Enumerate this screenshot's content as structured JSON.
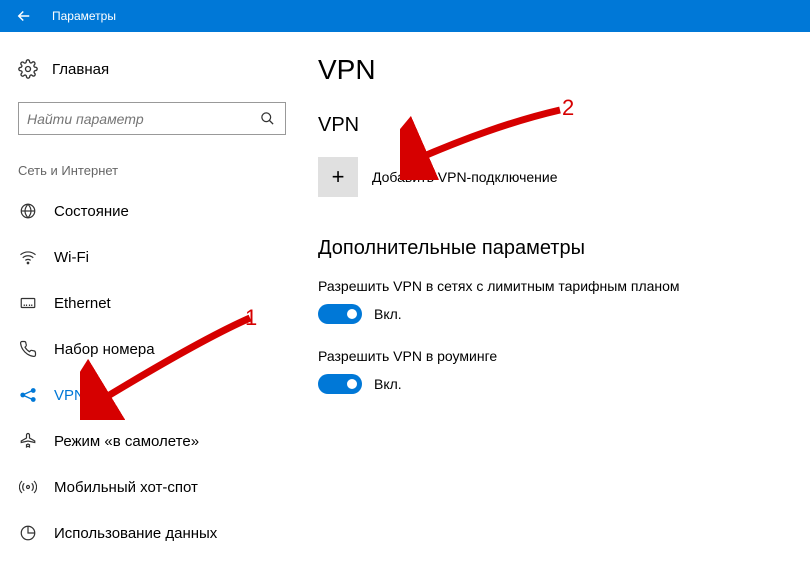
{
  "titlebar": {
    "title": "Параметры"
  },
  "sidebar": {
    "home_label": "Главная",
    "search_placeholder": "Найти параметр",
    "category_label": "Сеть и Интернет",
    "items": [
      {
        "label": "Состояние"
      },
      {
        "label": "Wi-Fi"
      },
      {
        "label": "Ethernet"
      },
      {
        "label": "Набор номера"
      },
      {
        "label": "VPN"
      },
      {
        "label": "Режим «в самолете»"
      },
      {
        "label": "Мобильный хот-спот"
      },
      {
        "label": "Использование данных"
      }
    ]
  },
  "main": {
    "page_title": "VPN",
    "vpn_heading": "VPN",
    "add_vpn_label": "Добавить VPN-подключение",
    "advanced_heading": "Дополнительные параметры",
    "settings": [
      {
        "label": "Разрешить VPN в сетях с лимитным тарифным планом",
        "state": "Вкл."
      },
      {
        "label": "Разрешить VPN в роуминге",
        "state": "Вкл."
      }
    ]
  },
  "annotations": {
    "num1": "1",
    "num2": "2"
  }
}
